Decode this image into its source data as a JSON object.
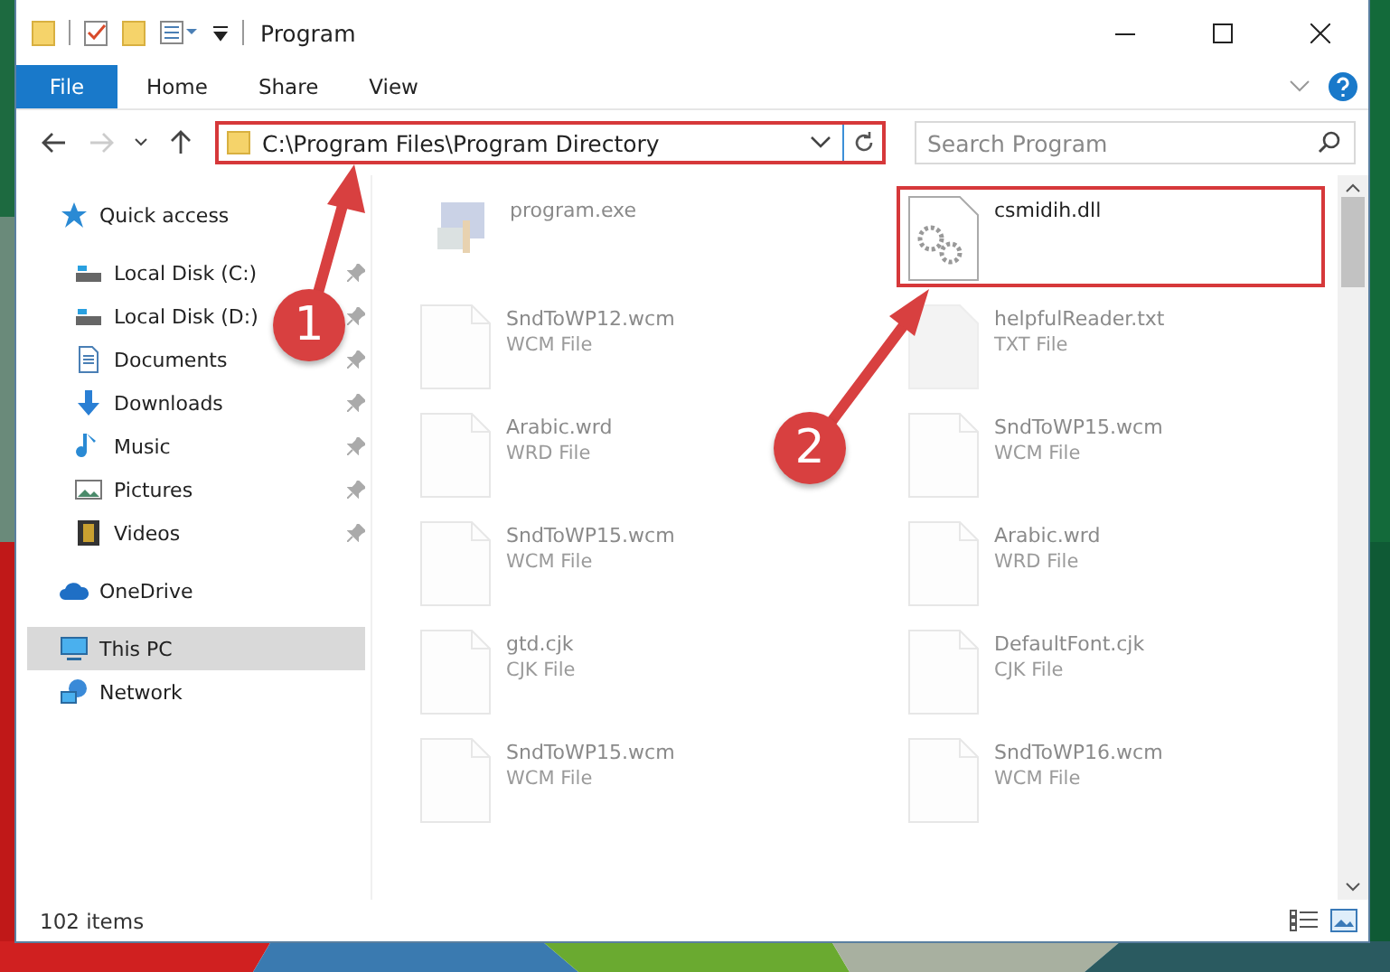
{
  "window": {
    "title": "Program"
  },
  "ribbon": {
    "tabs": [
      {
        "label": "File",
        "kind": "file"
      },
      {
        "label": "Home",
        "kind": "tab"
      },
      {
        "label": "Share",
        "kind": "tab"
      },
      {
        "label": "View",
        "kind": "tab"
      }
    ]
  },
  "address_bar": {
    "path": "C:\\Program Files\\Program Directory",
    "highlighted": true
  },
  "search": {
    "placeholder": "Search Program"
  },
  "navigation": [
    {
      "label": "Quick access",
      "kind": "star",
      "selected": false,
      "children": [
        {
          "label": "Local Disk (C:)",
          "kind": "drive",
          "pinned": true,
          "selected": false
        },
        {
          "label": "Local Disk (D:)",
          "kind": "drive",
          "pinned": true,
          "selected": false
        },
        {
          "label": "Documents",
          "kind": "document",
          "pinned": true,
          "selected": false
        },
        {
          "label": "Downloads",
          "kind": "download",
          "pinned": true,
          "selected": false
        },
        {
          "label": "Music",
          "kind": "music",
          "pinned": true,
          "selected": false
        },
        {
          "label": "Pictures",
          "kind": "picture",
          "pinned": true,
          "selected": false
        },
        {
          "label": "Videos",
          "kind": "video",
          "pinned": true,
          "selected": false
        }
      ]
    },
    {
      "label": "OneDrive",
      "kind": "cloud",
      "selected": false
    },
    {
      "label": "This PC",
      "kind": "pc",
      "selected": true
    },
    {
      "label": "Network",
      "kind": "network",
      "selected": false
    }
  ],
  "files": [
    {
      "name": "program.exe",
      "kind": "exe",
      "faded": true,
      "highlighted": false
    },
    {
      "name": "csmidih.dll",
      "kind": "dll",
      "faded": false,
      "highlighted": true
    },
    {
      "name": "SndToWP12.wcm",
      "type": "WCM File",
      "kind": "doc",
      "faded": true,
      "highlighted": false
    },
    {
      "name": "helpfulReader.txt",
      "type": "TXT File",
      "kind": "txt",
      "faded": true,
      "highlighted": false
    },
    {
      "name": "Arabic.wrd",
      "type": "WRD File",
      "kind": "doc",
      "faded": true,
      "highlighted": false
    },
    {
      "name": "SndToWP15.wcm",
      "type": "WCM File",
      "kind": "doc",
      "faded": true,
      "highlighted": false
    },
    {
      "name": "SndToWP15.wcm",
      "type": "WCM File",
      "kind": "doc",
      "faded": true,
      "highlighted": false
    },
    {
      "name": "Arabic.wrd",
      "type": "WRD File",
      "kind": "doc",
      "faded": true,
      "highlighted": false
    },
    {
      "name": "gtd.cjk",
      "type": "CJK File",
      "kind": "doc",
      "faded": true,
      "highlighted": false
    },
    {
      "name": "DefaultFont.cjk",
      "type": "CJK File",
      "kind": "doc",
      "faded": true,
      "highlighted": false
    },
    {
      "name": "SndToWP15.wcm",
      "type": "WCM File",
      "kind": "doc",
      "faded": true,
      "highlighted": false
    },
    {
      "name": "SndToWP16.wcm",
      "type": "WCM File",
      "kind": "doc",
      "faded": true,
      "highlighted": false
    }
  ],
  "status_bar": {
    "count": "102 items"
  },
  "annotations": [
    {
      "number": "1"
    },
    {
      "number": "2"
    }
  ]
}
